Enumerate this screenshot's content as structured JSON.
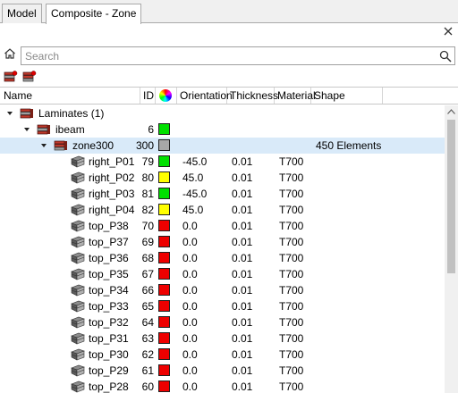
{
  "tabs": [
    {
      "label": "Model",
      "active": false
    },
    {
      "label": "Composite - Zone",
      "active": true
    }
  ],
  "search": {
    "placeholder": "Search"
  },
  "columns": {
    "name": "Name",
    "id": "ID",
    "color": "color-wheel-icon",
    "orientation": "Orientation",
    "thickness": "Thickness",
    "material": "Material",
    "shape": "Shape"
  },
  "colors": {
    "green": "#00e000",
    "yellow": "#ffff00",
    "red": "#ee0000",
    "gray": "#a8a8a8",
    "selection": "#d9eaf9"
  },
  "tree": {
    "root": {
      "name": "Laminates (1)",
      "icon": "laminate-icon"
    },
    "laminate": {
      "name": "ibeam",
      "id": "6",
      "color": "green",
      "icon": "laminate-icon"
    },
    "zone": {
      "name": "zone300",
      "id": "300",
      "color": "gray",
      "shape": "450 Elements",
      "icon": "zone-icon"
    },
    "plies": [
      {
        "name": "right_P01",
        "id": "79",
        "color": "green",
        "orientation": "-45.0",
        "thickness": "0.01",
        "material": "T700"
      },
      {
        "name": "right_P02",
        "id": "80",
        "color": "yellow",
        "orientation": "45.0",
        "thickness": "0.01",
        "material": "T700"
      },
      {
        "name": "right_P03",
        "id": "81",
        "color": "green",
        "orientation": "-45.0",
        "thickness": "0.01",
        "material": "T700"
      },
      {
        "name": "right_P04",
        "id": "82",
        "color": "yellow",
        "orientation": "45.0",
        "thickness": "0.01",
        "material": "T700"
      },
      {
        "name": "top_P38",
        "id": "70",
        "color": "red",
        "orientation": "0.0",
        "thickness": "0.01",
        "material": "T700"
      },
      {
        "name": "top_P37",
        "id": "69",
        "color": "red",
        "orientation": "0.0",
        "thickness": "0.01",
        "material": "T700"
      },
      {
        "name": "top_P36",
        "id": "68",
        "color": "red",
        "orientation": "0.0",
        "thickness": "0.01",
        "material": "T700"
      },
      {
        "name": "top_P35",
        "id": "67",
        "color": "red",
        "orientation": "0.0",
        "thickness": "0.01",
        "material": "T700"
      },
      {
        "name": "top_P34",
        "id": "66",
        "color": "red",
        "orientation": "0.0",
        "thickness": "0.01",
        "material": "T700"
      },
      {
        "name": "top_P33",
        "id": "65",
        "color": "red",
        "orientation": "0.0",
        "thickness": "0.01",
        "material": "T700"
      },
      {
        "name": "top_P32",
        "id": "64",
        "color": "red",
        "orientation": "0.0",
        "thickness": "0.01",
        "material": "T700"
      },
      {
        "name": "top_P31",
        "id": "63",
        "color": "red",
        "orientation": "0.0",
        "thickness": "0.01",
        "material": "T700"
      },
      {
        "name": "top_P30",
        "id": "62",
        "color": "red",
        "orientation": "0.0",
        "thickness": "0.01",
        "material": "T700"
      },
      {
        "name": "top_P29",
        "id": "61",
        "color": "red",
        "orientation": "0.0",
        "thickness": "0.01",
        "material": "T700"
      },
      {
        "name": "top_P28",
        "id": "60",
        "color": "red",
        "orientation": "0.0",
        "thickness": "0.01",
        "material": "T700"
      }
    ]
  }
}
